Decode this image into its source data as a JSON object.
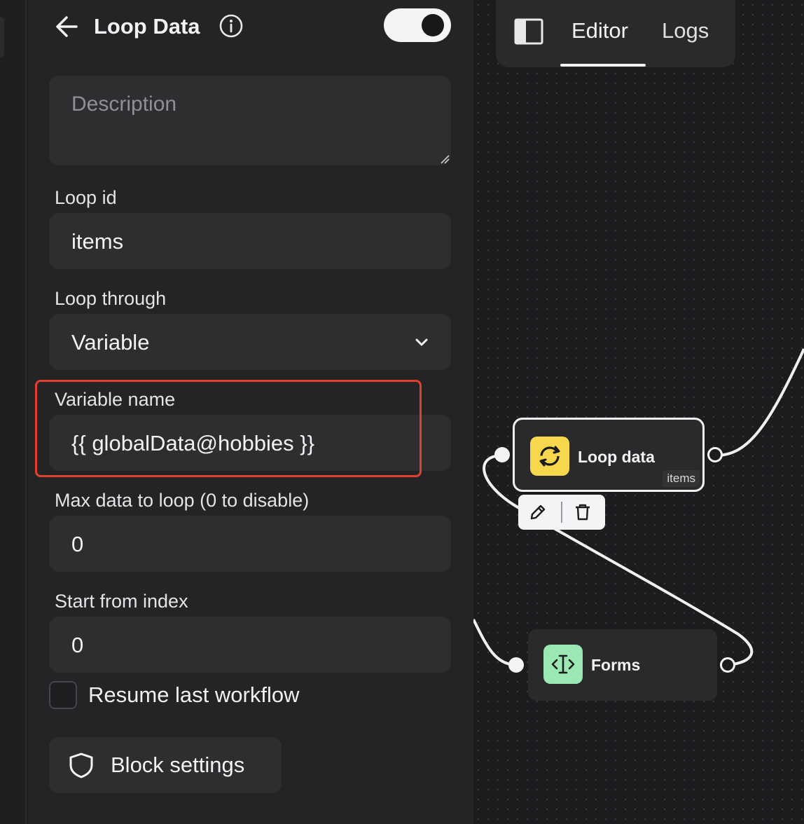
{
  "panel": {
    "title": "Loop Data",
    "toggle_on": true,
    "description": {
      "placeholder": "Description",
      "value": ""
    },
    "loop_id": {
      "label": "Loop id",
      "value": "items"
    },
    "loop_through": {
      "label": "Loop through",
      "value": "Variable"
    },
    "variable_name": {
      "label": "Variable name",
      "value": "{{ globalData@hobbies }}"
    },
    "max_data": {
      "label": "Max data to loop (0 to disable)",
      "value": "0"
    },
    "start_index": {
      "label": "Start from index",
      "value": "0"
    },
    "resume": {
      "label": "Resume last workflow",
      "checked": false
    },
    "block_settings": {
      "label": "Block settings"
    },
    "icons": [
      "arrow-left-icon",
      "info-icon",
      "chevron-down-icon",
      "shield-icon"
    ]
  },
  "canvas": {
    "tabs": [
      {
        "label": "Editor",
        "active": true
      },
      {
        "label": "Logs",
        "active": false
      }
    ],
    "nodes": [
      {
        "name": "Loop data",
        "tag": "items",
        "icon": "refresh-icon",
        "color": "#f7d84d",
        "selected": true
      },
      {
        "name": "Forms",
        "icon": "text-cursor-icon",
        "color": "#9be8b4",
        "selected": false
      }
    ]
  },
  "colors": {
    "panel_bg": "#242427",
    "field_bg": "#2e2e31",
    "highlight": "#e0402c",
    "canvas_bg": "#1c1c1e"
  }
}
